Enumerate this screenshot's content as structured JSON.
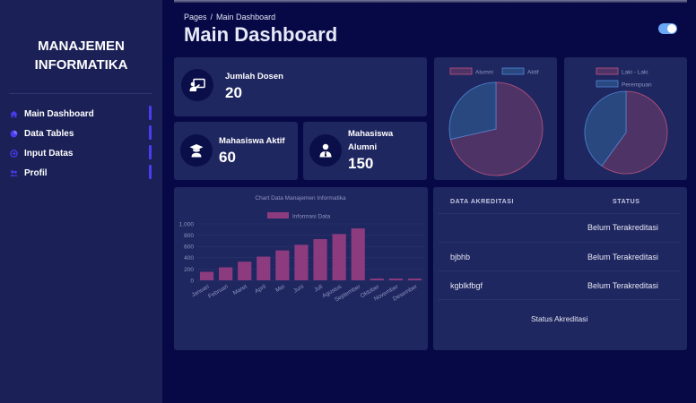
{
  "sidebar": {
    "brand_line1": "MANAJEMEN",
    "brand_line2": "INFORMATIKA",
    "items": [
      {
        "label": "Main Dashboard",
        "icon": "home-icon"
      },
      {
        "label": "Data Tables",
        "icon": "chart-pie-icon"
      },
      {
        "label": "Input Datas",
        "icon": "input-icon"
      },
      {
        "label": "Profil",
        "icon": "users-icon"
      }
    ]
  },
  "header": {
    "breadcrumb": [
      "Pages",
      "Main Dashboard"
    ],
    "breadcrumb_sep": "/",
    "title": "Main Dashboard"
  },
  "stats": {
    "dosen": {
      "label": "Jumlah Dosen",
      "value": "20",
      "icon": "teacher-board-icon"
    },
    "aktif": {
      "label": "Mahasiswa Aktif",
      "value": "60",
      "icon": "graduate-icon"
    },
    "alumni": {
      "label_line1": "Mahasiswa",
      "label_line2": "Alumni",
      "value": "150",
      "icon": "user-tie-icon"
    }
  },
  "colors": {
    "accent": "#4a3cf0",
    "pink": "#8c3c7e",
    "blue": "#2f4f98",
    "background": "#060946",
    "card": "#1f2760",
    "sidebar": "#1b2157"
  },
  "chart_data": [
    {
      "type": "pie",
      "labels": [
        "Alumni",
        "Aktif"
      ],
      "values": [
        150,
        60
      ],
      "colors": [
        "#4e3466",
        "#29487f"
      ],
      "legend": "top"
    },
    {
      "type": "pie",
      "labels": [
        "Laki - Laki",
        "Perempuan"
      ],
      "values": [
        60,
        40
      ],
      "colors": [
        "#4e3466",
        "#29487f"
      ],
      "legend": "top"
    },
    {
      "type": "bar",
      "title": "Chart Data Manajemen Informatika",
      "series": [
        {
          "name": "Informasi Data",
          "values": [
            150,
            230,
            330,
            420,
            530,
            630,
            730,
            820,
            920,
            30,
            30,
            30
          ]
        }
      ],
      "categories": [
        "Januari",
        "Februari",
        "Maret",
        "April",
        "Mei",
        "Juni",
        "Juli",
        "Agustus",
        "September",
        "Oktober",
        "November",
        "Desember"
      ],
      "y_ticks": [
        "0",
        "200",
        "400",
        "600",
        "800",
        "1.000"
      ],
      "ylim": [
        0,
        1000
      ],
      "grid": true,
      "legend": "top"
    }
  ],
  "table": {
    "headers": [
      "DATA AKREDITASI",
      "STATUS"
    ],
    "rows": [
      {
        "name": "",
        "status": "Belum Terakreditasi"
      },
      {
        "name": "bjbhb",
        "status": "Belum Terakreditasi"
      },
      {
        "name": "kgblkfbgf",
        "status": "Belum Terakreditasi"
      }
    ],
    "footer": "Status Akreditasi"
  }
}
